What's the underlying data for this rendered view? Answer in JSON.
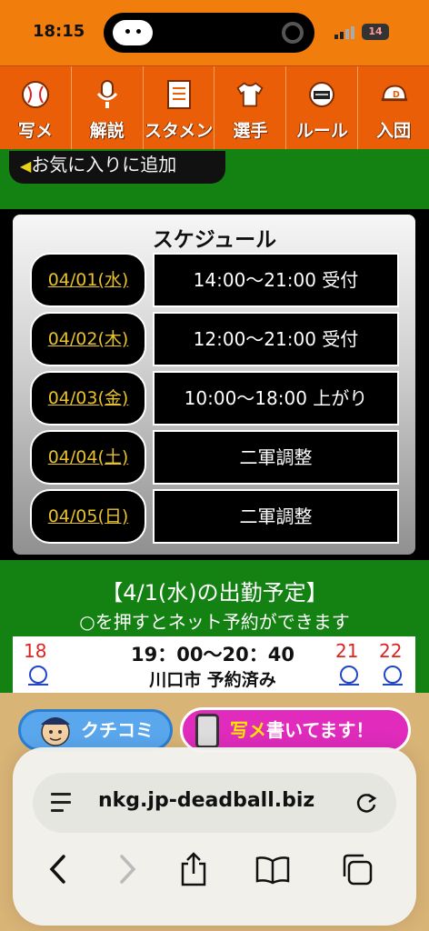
{
  "status_bar": {
    "time": "18:15",
    "battery": "14"
  },
  "nav": {
    "items": [
      {
        "label": "写メ",
        "icon": "baseball-icon"
      },
      {
        "label": "解説",
        "icon": "microphone-icon"
      },
      {
        "label": "スタメン",
        "icon": "lineup-sheet-icon"
      },
      {
        "label": "選手",
        "icon": "uniform-icon"
      },
      {
        "label": "ルール",
        "icon": "umpire-mask-icon"
      },
      {
        "label": "入団",
        "icon": "cap-icon"
      }
    ]
  },
  "favorites": {
    "label": "お気に入りに追加",
    "arrow": "◀"
  },
  "schedule": {
    "title": "スケジュール",
    "rows": [
      {
        "date": "04/01(水)",
        "time": "14:00〜21:00 受付"
      },
      {
        "date": "04/02(木)",
        "time": "12:00〜21:00 受付"
      },
      {
        "date": "04/03(金)",
        "time": "10:00〜18:00 上がり"
      },
      {
        "date": "04/04(土)",
        "time": "二軍調整"
      },
      {
        "date": "04/05(日)",
        "time": "二軍調整"
      }
    ]
  },
  "attendance": {
    "title": "【4/1(水)の出勤予定】",
    "subtitle": "○を押すとネット予約ができます",
    "hour_left": "18",
    "hour_right_1": "21",
    "hour_right_2": "22",
    "time": "19：00〜20：40",
    "location": "川口市 予約済み"
  },
  "buttons": {
    "kuchikomi": "クチコミ",
    "shame_highlight": "写メ",
    "shame_rest": "書いてます！"
  },
  "browser": {
    "url": "nkg.jp-deadball.biz"
  }
}
